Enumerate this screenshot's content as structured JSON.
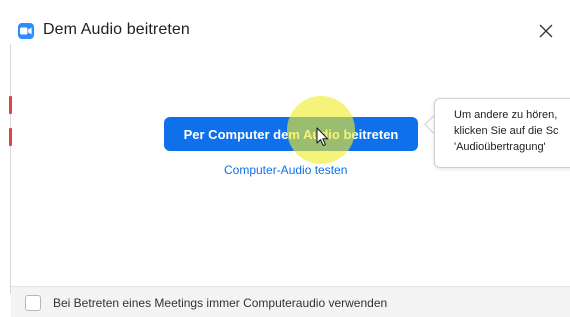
{
  "window": {
    "title": "Dem Audio beitreten",
    "app_icon": "zoom-camera-icon",
    "close_icon": "close-icon"
  },
  "main": {
    "join_button_label": "Per Computer dem Audio beitreten",
    "test_link_label": "Computer-Audio testen"
  },
  "tooltip": {
    "line1": "Um andere zu hören,",
    "line2": "klicken Sie auf die Sc",
    "line3": "'Audioübertragung'"
  },
  "footer": {
    "checkbox_checked": false,
    "checkbox_label": "Bei Betreten eines Meetings immer Computeraudio verwenden"
  },
  "colors": {
    "accent": "#0e71eb",
    "app_icon": "#2d8cff",
    "highlight": "#f0ec28"
  }
}
